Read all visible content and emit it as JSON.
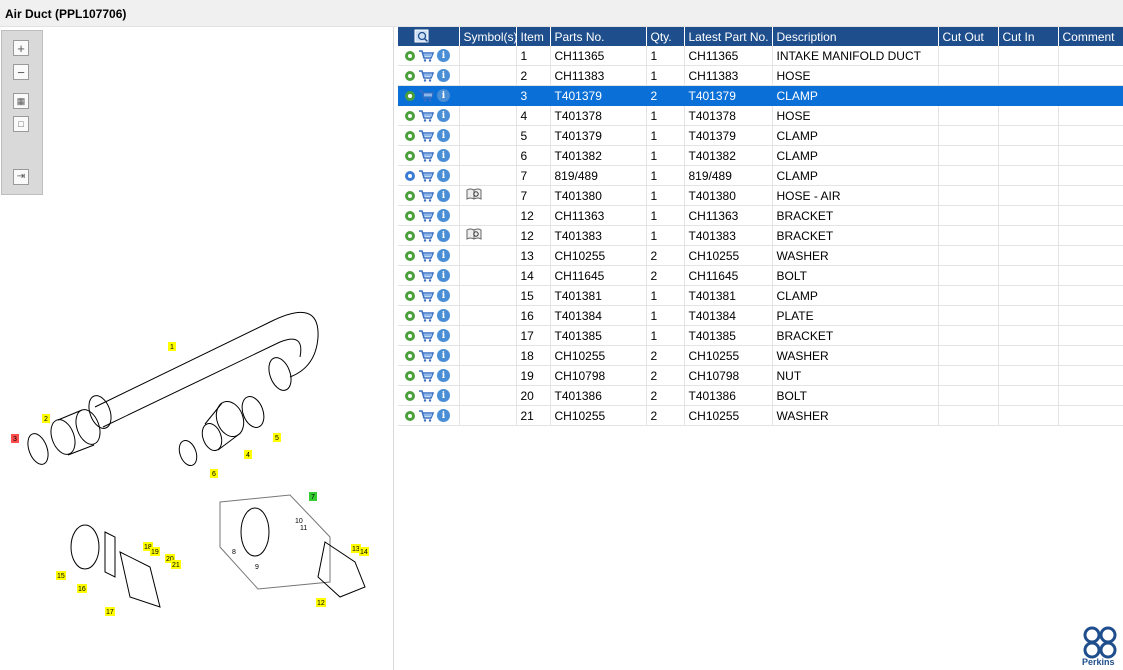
{
  "window": {
    "title": "Air Duct (PPL107706)"
  },
  "toolbar": {
    "icons": [
      "zoom-in-icon",
      "zoom-out-icon",
      "fit-all-icon",
      "fit-window-icon",
      "toggle-panel-icon"
    ]
  },
  "grid": {
    "headers": {
      "symbols": "Symbol(s)",
      "item": "Item",
      "parts_no": "Parts No.",
      "qty": "Qty.",
      "latest_part_no": "Latest Part No.",
      "description": "Description",
      "cut_out": "Cut Out",
      "cut_in": "Cut In",
      "comment": "Comment"
    },
    "rows": [
      {
        "item": "1",
        "part": "CH11365",
        "qty": "1",
        "latest": "CH11365",
        "desc": "INTAKE MANIFOLD DUCT",
        "symbol": ""
      },
      {
        "item": "2",
        "part": "CH11383",
        "qty": "1",
        "latest": "CH11383",
        "desc": "HOSE",
        "symbol": ""
      },
      {
        "item": "3",
        "part": "T401379",
        "qty": "2",
        "latest": "T401379",
        "desc": "CLAMP",
        "symbol": "",
        "selected": true
      },
      {
        "item": "4",
        "part": "T401378",
        "qty": "1",
        "latest": "T401378",
        "desc": "HOSE",
        "symbol": ""
      },
      {
        "item": "5",
        "part": "T401379",
        "qty": "1",
        "latest": "T401379",
        "desc": "CLAMP",
        "symbol": ""
      },
      {
        "item": "6",
        "part": "T401382",
        "qty": "1",
        "latest": "T401382",
        "desc": "CLAMP",
        "symbol": ""
      },
      {
        "item": "7",
        "part": "819/489",
        "qty": "1",
        "latest": "819/489",
        "desc": "CLAMP",
        "symbol": "",
        "alt_gear": true
      },
      {
        "item": "7",
        "part": "T401380",
        "qty": "1",
        "latest": "T401380",
        "desc": "HOSE - AIR",
        "symbol": "book"
      },
      {
        "item": "12",
        "part": "CH11363",
        "qty": "1",
        "latest": "CH11363",
        "desc": "BRACKET",
        "symbol": ""
      },
      {
        "item": "12",
        "part": "T401383",
        "qty": "1",
        "latest": "T401383",
        "desc": "BRACKET",
        "symbol": "book"
      },
      {
        "item": "13",
        "part": "CH10255",
        "qty": "2",
        "latest": "CH10255",
        "desc": "WASHER",
        "symbol": ""
      },
      {
        "item": "14",
        "part": "CH11645",
        "qty": "2",
        "latest": "CH11645",
        "desc": "BOLT",
        "symbol": ""
      },
      {
        "item": "15",
        "part": "T401381",
        "qty": "1",
        "latest": "T401381",
        "desc": "CLAMP",
        "symbol": ""
      },
      {
        "item": "16",
        "part": "T401384",
        "qty": "1",
        "latest": "T401384",
        "desc": "PLATE",
        "symbol": ""
      },
      {
        "item": "17",
        "part": "T401385",
        "qty": "1",
        "latest": "T401385",
        "desc": "BRACKET",
        "symbol": ""
      },
      {
        "item": "18",
        "part": "CH10255",
        "qty": "2",
        "latest": "CH10255",
        "desc": "WASHER",
        "symbol": ""
      },
      {
        "item": "19",
        "part": "CH10798",
        "qty": "2",
        "latest": "CH10798",
        "desc": "NUT",
        "symbol": ""
      },
      {
        "item": "20",
        "part": "T401386",
        "qty": "2",
        "latest": "T401386",
        "desc": "BOLT",
        "symbol": ""
      },
      {
        "item": "21",
        "part": "CH10255",
        "qty": "2",
        "latest": "CH10255",
        "desc": "WASHER",
        "symbol": ""
      }
    ]
  },
  "diagram": {
    "callouts": [
      "1",
      "2",
      "3",
      "4",
      "5",
      "6",
      "7",
      "8",
      "9",
      "10",
      "11",
      "12",
      "13",
      "14",
      "15",
      "16",
      "17",
      "18",
      "19",
      "20",
      "21"
    ]
  },
  "brand": {
    "name": "Perkins",
    "color": "#1f4e8c"
  },
  "colors": {
    "header_bg": "#1f4e8c",
    "selected_row": "#0a6fd6",
    "callout_yellow": "#ffff00",
    "callout_red": "#ff4d4d",
    "callout_green": "#33cc33"
  }
}
